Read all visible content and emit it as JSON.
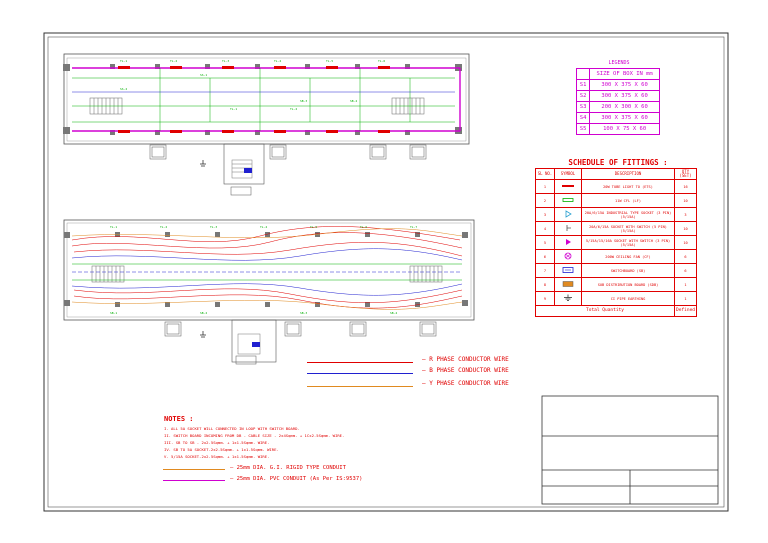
{
  "legend": {
    "title": "LEGENDS",
    "size_header": "SIZE OF BOX IN mm",
    "boxes": [
      {
        "code": "S1",
        "size": "300 X 375 X 60"
      },
      {
        "code": "S2",
        "size": "300 X 375 X 60"
      },
      {
        "code": "S3",
        "size": "200 X 300 X 60"
      },
      {
        "code": "S4",
        "size": "300 X 375 X 60"
      },
      {
        "code": "S5",
        "size": "100 X 75 X 60"
      }
    ]
  },
  "schedule": {
    "title": "SCHEDULE OF FITTINGS :",
    "headers": [
      "SL NO.",
      "SYMBOL",
      "DESCRIPTION",
      "QTY (SET)"
    ],
    "rows": [
      {
        "sl": "1",
        "desc": "20W TUBE LIGHT TO (ETS)",
        "qty": "16"
      },
      {
        "sl": "2",
        "desc": "11W CFL (LF)",
        "qty": "10"
      },
      {
        "sl": "3",
        "desc": "20A/6/15A INDUSTRIAL TYPE SOCKET (3 PIN) (5/15A)",
        "qty": "3"
      },
      {
        "sl": "4",
        "desc": "20A/6/15A SOCKET WITH SWITCH (5 PIN) (5/15A)",
        "qty": "10"
      },
      {
        "sl": "5",
        "desc": "5/15A/15/16A SOCKET WITH SWITCH (3 PIN) (5/15A)",
        "qty": "10"
      },
      {
        "sl": "6",
        "desc": "200W CEILING FAN (CF)",
        "qty": "6"
      },
      {
        "sl": "7",
        "desc": "SWITCHBOARD (SB)",
        "qty": "6"
      },
      {
        "sl": "8",
        "desc": "SUB DISTRIBUTION BOARD (SDB)",
        "qty": "1"
      },
      {
        "sl": "9",
        "desc": "CI PIPE EARTHING",
        "qty": "1"
      }
    ],
    "total_label": "Total Quantity",
    "total_value": "Defined"
  },
  "wire_legend": [
    {
      "label": "R PHASE CONDUCTOR WIRE",
      "color": "#e00000"
    },
    {
      "label": "B PHASE CONDUCTOR WIRE",
      "color": "#2020d0"
    },
    {
      "label": "Y PHASE CONDUCTOR WIRE",
      "color": "#e08a20"
    }
  ],
  "notes": {
    "title": "NOTES :",
    "items": [
      "I. ALL 5A SOCKET WILL CONNECTED IN LOOP WITH SWITCH BOARD.",
      "II. SWITCH BOARD INCOMING FROM DB - CABLE SIZE - 2x4Sqmm. + 1Cx2.5Sqmm. WIRE.",
      "III. SB TO SB - 2x2.5Sqmm. + 1x1.5Sqmm. WIRE.",
      "IV. SB TO 5A SOCKET-2x2.5Sqmm. + 1x1.5Sqmm. WIRE.",
      "V. 5/15A SOCKET-2x2.5Sqmm. + 1x1.5Sqmm. WIRE."
    ]
  },
  "conduits": [
    {
      "label": "25mm DIA. G.I. RIGID TYPE CONDUIT",
      "color": "#e08a20"
    },
    {
      "label": "25mm DIA. PVC CONDUIT (As Per IS:9537)",
      "color": "#d000d0"
    }
  ],
  "colors": {
    "green": "#00b000",
    "magenta": "#d000d0",
    "red": "#e00000",
    "blue": "#2020d0",
    "orange": "#e08a20"
  }
}
